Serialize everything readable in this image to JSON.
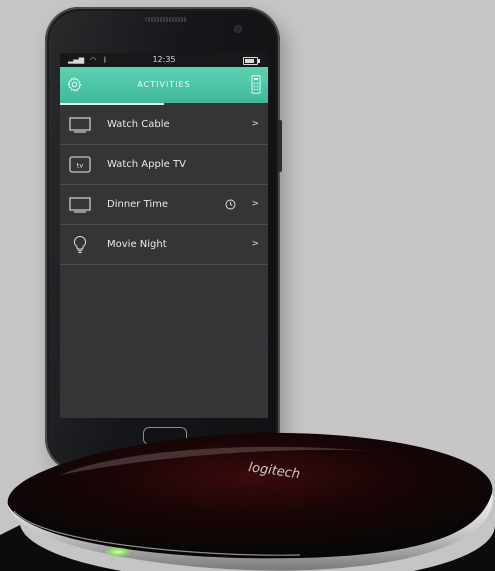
{
  "status_bar": {
    "time": "12:35",
    "signal_icon": "signal-icon",
    "wifi_icon": "wifi-icon",
    "bluetooth_icon": "bluetooth-icon",
    "battery_icon": "battery-icon"
  },
  "header": {
    "title": "ACTIVITIES",
    "settings_icon": "gear-icon",
    "remote_icon": "remote-icon",
    "accent_color": "#4cc4a5"
  },
  "activities": [
    {
      "label": "Watch Cable",
      "icon": "tv-icon",
      "has_chevron": true,
      "chevron": ">"
    },
    {
      "label": "Watch Apple TV",
      "icon": "apple-tv-icon",
      "has_chevron": false
    },
    {
      "label": "Dinner Time",
      "icon": "tv-icon",
      "has_chevron": true,
      "chevron": ">",
      "timer_icon": "clock-icon"
    },
    {
      "label": "Movie Night",
      "icon": "lightbulb-icon",
      "has_chevron": true,
      "chevron": ">"
    }
  ],
  "apple_tv_badge": "tv",
  "hub": {
    "brand": "logitech",
    "status_light_color": "#8ee86a"
  }
}
